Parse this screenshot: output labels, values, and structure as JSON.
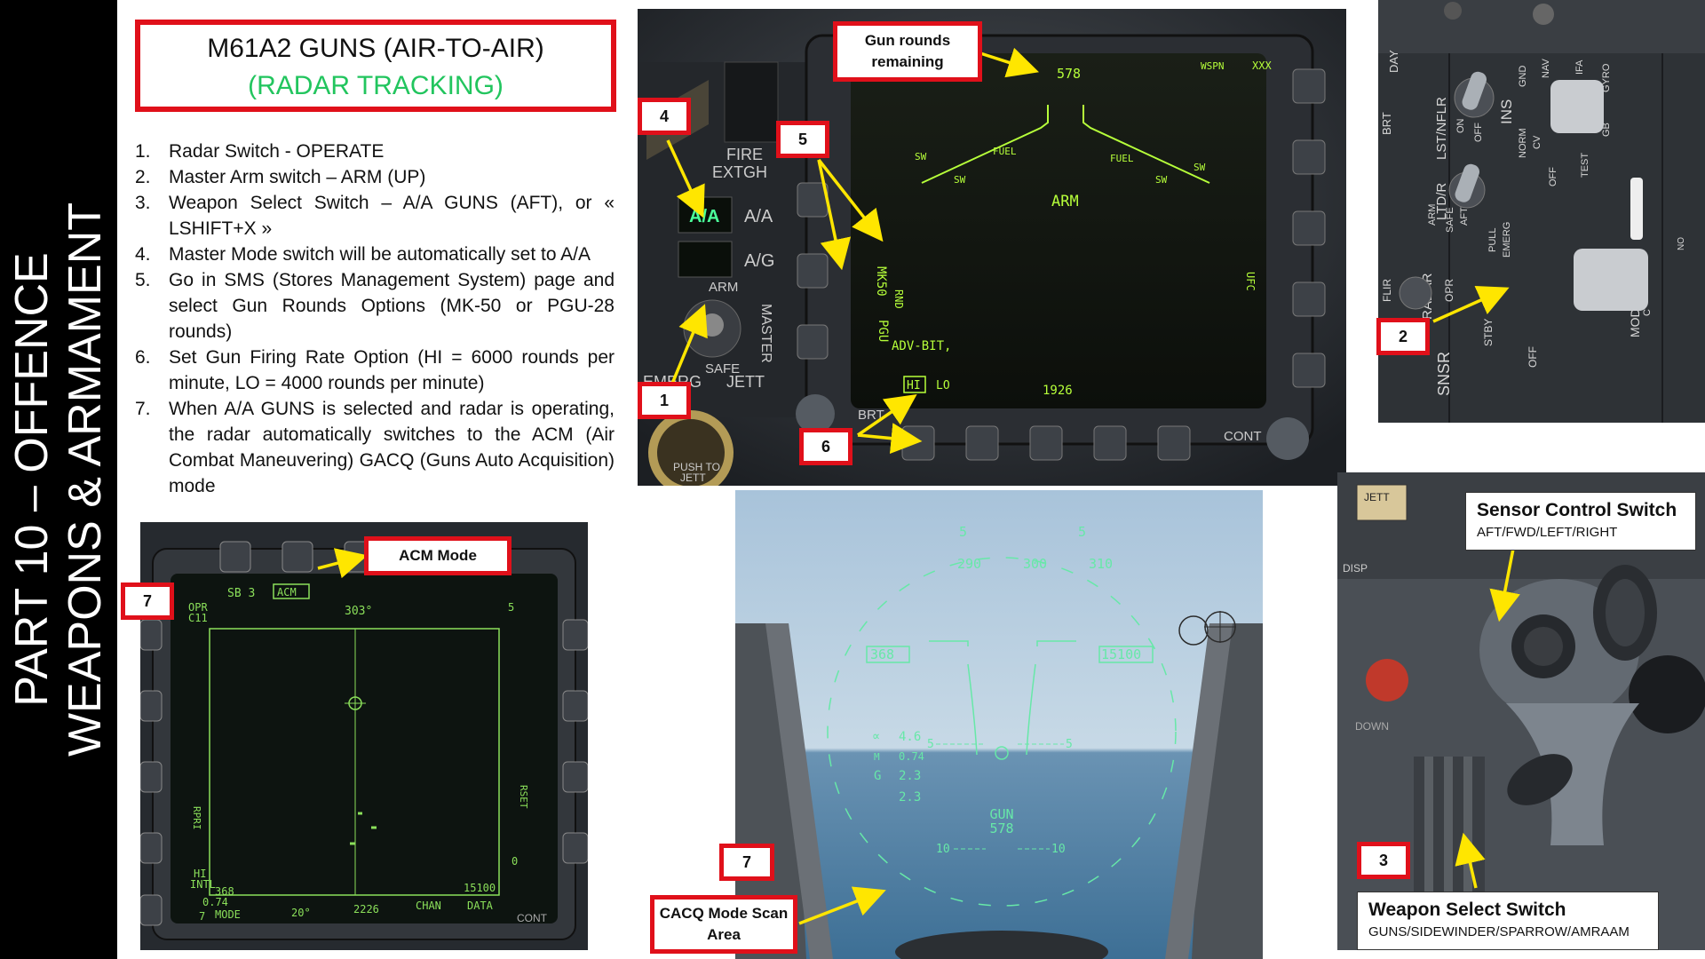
{
  "sidebar": {
    "line1": "PART 10 – OFFENCE",
    "line2": "WEAPONS & ARMAMENT"
  },
  "title": {
    "main": "M61A2 GUNS (AIR-TO-AIR)",
    "sub": "(RADAR TRACKING)"
  },
  "steps": [
    {
      "n": "1.",
      "text": "Radar Switch - OPERATE"
    },
    {
      "n": "2.",
      "text": "Master Arm switch – ARM (UP)"
    },
    {
      "n": "3.",
      "text": "Weapon Select Switch – A/A GUNS (AFT), or « LSHIFT+X »"
    },
    {
      "n": "4.",
      "text": "Master Mode switch will be automatically set to A/A"
    },
    {
      "n": "5.",
      "text": "Go in SMS (Stores Management System) page and select Gun Rounds Options (MK-50 or PGU-28 rounds)"
    },
    {
      "n": "6.",
      "text": "Set Gun Firing Rate Option (HI = 6000 rounds per minute, LO = 4000 rounds per minute)"
    },
    {
      "n": "7.",
      "text": "When A/A GUNS is selected and radar is operating, the radar automatically switches to the ACM (Air Combat Maneuvering) GACQ (Guns Auto Acquisition) mode"
    }
  ],
  "sms": {
    "rounds": "578",
    "wpn": "WSPN",
    "xxx": "XXX",
    "arm": "ARM",
    "sw": "SW",
    "fuel": "FUEL",
    "adv_bit": "ADV-BIT,",
    "hi": "HI",
    "lo": "LO",
    "num": "1926",
    "pgu": "PGU",
    "mk50": "MK50",
    "rnd": "RND",
    "ufc": "UFC",
    "fire": "FIRE",
    "extgh": "EXTGH",
    "aa_lit": "A/A",
    "aa": "A/A",
    "ag": "A/G",
    "arm_sw": "ARM",
    "safe": "SAFE",
    "master": "MASTER",
    "emerg": "EMERG",
    "jett": "JETT",
    "brt": "BRT",
    "cont": "CONT",
    "push": "PUSH TO",
    "jett2": "JETT"
  },
  "panel2": {
    "day": "DAY",
    "brt": "BRT",
    "lst": "LST/NFLR",
    "on": "ON",
    "off": "OFF",
    "ins": "INS",
    "nav": "NAV",
    "ifa": "IFA",
    "gyro": "GYRO",
    "gnd": "GND",
    "norm": "NORM",
    "cv": "CV",
    "gb": "GB",
    "test": "TEST",
    "off2": "OFF",
    "ltd": "LTD/R",
    "arm": "ARM",
    "safe": "SAFE",
    "aft": "AFT",
    "pull": "PULL",
    "emerg": "EMERG",
    "radar": "RADAR",
    "opr": "OPR",
    "stby": "STBY",
    "off3": "OFF",
    "flir": "FLIR",
    "sns": "SNSR",
    "mode": "MODE",
    "c": "C",
    "no": "NO"
  },
  "radar": {
    "sb": "SB 3",
    "acm": "ACM",
    "hdg": "303°",
    "opr": "OPR",
    "c11": "C11",
    "five": "5",
    "zero": "0",
    "rset": "RSET",
    "rpri": "RPRI",
    "hi": "HI",
    "intl": "INTL",
    "b368": "368",
    "mach": "0.74",
    "mode": "MODE",
    "deg": "20°",
    "v2226": "2226",
    "chan": "CHAN",
    "alt": "15100",
    "data": "DATA",
    "seven": "7",
    "cont": "CONT"
  },
  "hud": {
    "t290": "290",
    "t300": "300",
    "t310": "310",
    "spd": "368",
    "alt": "15100",
    "aoa_sym": "∝",
    "aoa": "4.6",
    "m_lbl": "M",
    "mach": "0.74",
    "g_lbl": "G",
    "g": "2.3",
    "g2": "2.3",
    "gun": "GUN",
    "rounds": "578",
    "p5l": "5",
    "p5r": "5",
    "p10l": "10",
    "p10r": "10"
  },
  "panel3": {
    "jett": "JETT",
    "disp": "DISP",
    "down": "DOWN"
  },
  "callouts": {
    "gun_rounds": "Gun rounds remaining",
    "c4": "4",
    "c5": "5",
    "c1": "1",
    "c6": "6",
    "c2": "2",
    "acm_mode": "ACM Mode",
    "c7a": "7",
    "c7b": "7",
    "cacq": "CACQ Mode Scan Area",
    "c3": "3"
  },
  "sensor_caption": {
    "title": "Sensor Control Switch",
    "sub": "AFT/FWD/LEFT/RIGHT"
  },
  "weapon_caption": {
    "title": "Weapon Select Switch",
    "sub": "GUNS/SIDEWINDER/SPARROW/AMRAAM"
  },
  "colors": {
    "callout_border": "#e0101a",
    "arrow": "#ffe600",
    "mfd_green": "#b6ff3a",
    "subtitle_green": "#22c55e"
  }
}
